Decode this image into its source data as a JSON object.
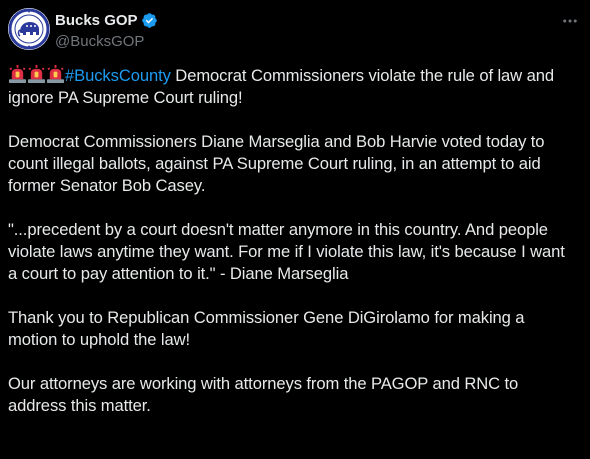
{
  "author": {
    "display_name": "Bucks GOP",
    "handle": "@BucksGOP",
    "verified": true,
    "avatar_icon": "bucks-gop-logo",
    "brand_color": "#2b3a9a"
  },
  "icons": {
    "alert": "rotating-light-emoji",
    "more": "more-options-icon",
    "verified": "verified-badge-icon"
  },
  "colors": {
    "background": "#000000",
    "text": "#e7e9ea",
    "muted": "#71767b",
    "link": "#1d9bf0",
    "verified": "#1d9bf0"
  },
  "tweet": {
    "hashtag": "#BucksCounty",
    "line1_rest": " Democrat Commissioners violate the rule of law and ignore PA Supreme Court ruling!",
    "para2": "Democrat Commissioners Diane Marseglia and Bob Harvie voted today to count illegal ballots, against PA Supreme Court ruling, in an attempt to aid former Senator Bob Casey.",
    "para3": "\"...precedent by a court doesn't matter anymore in this country. And people violate laws anytime they want. For me if I violate this law, it's because I want a court to pay attention to it.\" - Diane Marseglia",
    "para4": "Thank you to Republican Commissioner Gene DiGirolamo for making a motion to uphold the law!",
    "para5": "Our attorneys are working with attorneys from the PAGOP and RNC to address this matter."
  }
}
